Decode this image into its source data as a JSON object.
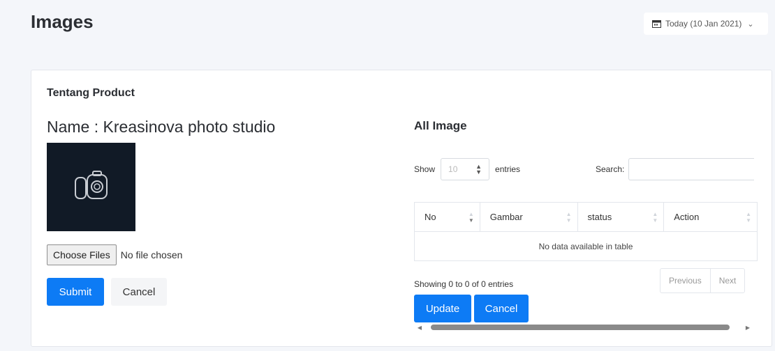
{
  "header": {
    "title": "Images",
    "date_label": "Today (10 Jan 2021)"
  },
  "product": {
    "section_title": "Tentang Product",
    "name": "Name : Kreasinova photo studio",
    "image_icon": "camera-icon"
  },
  "upload": {
    "choose_label": "Choose Files",
    "file_status": "No file chosen",
    "submit_label": "Submit",
    "cancel_label": "Cancel"
  },
  "images_table": {
    "title": "All Image",
    "show_label": "Show",
    "page_length": "10",
    "entries_label": "entries",
    "search_label": "Search:",
    "columns": [
      "No",
      "Gambar",
      "status",
      "Action"
    ],
    "empty_message": "No data available in table",
    "info": "Showing 0 to 0 of 0 entries",
    "previous_label": "Previous",
    "next_label": "Next",
    "update_label": "Update",
    "cancel_label": "Cancel"
  },
  "colors": {
    "primary": "#0d7bf5",
    "thumbnail_bg": "#111a26",
    "page_bg": "#f4f6fa"
  }
}
